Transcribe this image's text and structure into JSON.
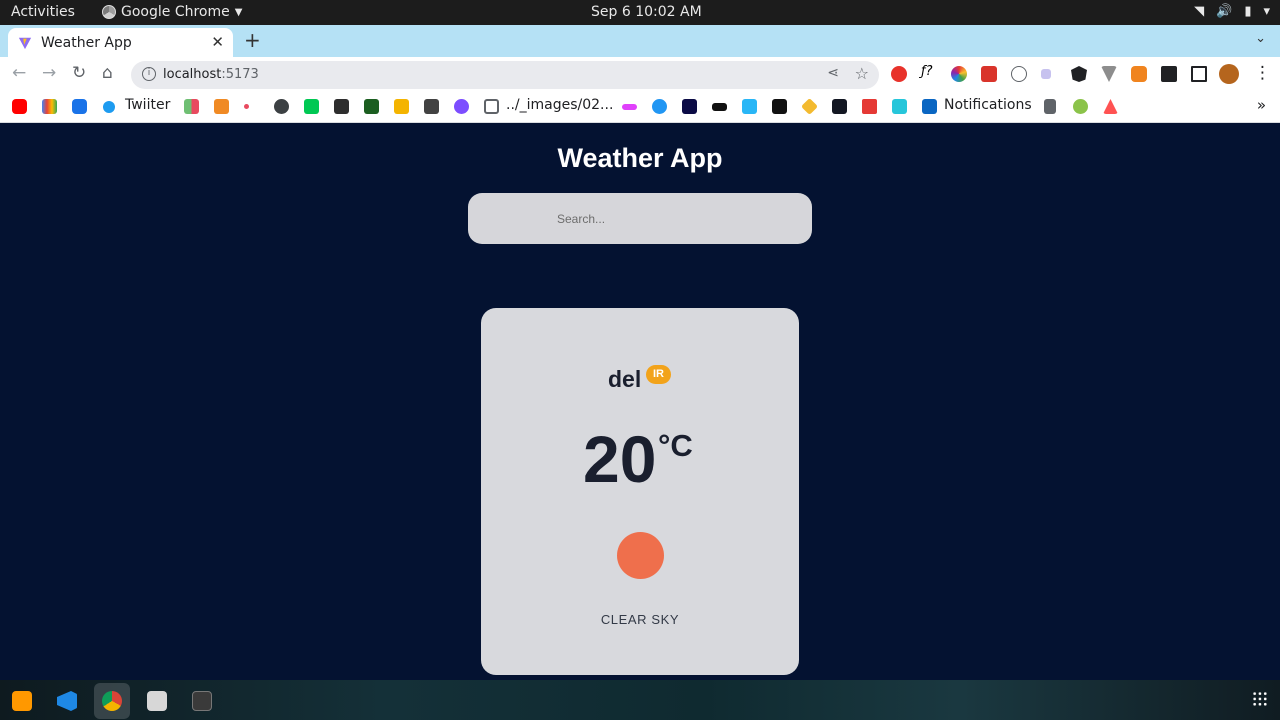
{
  "system_bar": {
    "activities": "Activities",
    "app_name": "Google Chrome",
    "clock": "Sep 6  10:02 AM"
  },
  "browser": {
    "tab": {
      "title": "Weather App"
    },
    "address": {
      "host": "localhost",
      "port": ":5173"
    },
    "bookmarks": {
      "twitter": "Twiiter",
      "images": "../_images/02...",
      "notifications": "Notifications"
    }
  },
  "app": {
    "title": "Weather App",
    "search": {
      "placeholder": "Search...",
      "value": ""
    },
    "weather": {
      "city": "del",
      "country": "IR",
      "temperature": "20",
      "unit": "°C",
      "description": "CLEAR SKY"
    }
  },
  "colors": {
    "page_background": "#041231",
    "card_background": "#d8d9dd",
    "country_badge": "#f2a31a",
    "weather_icon": "#ef6f4c"
  }
}
